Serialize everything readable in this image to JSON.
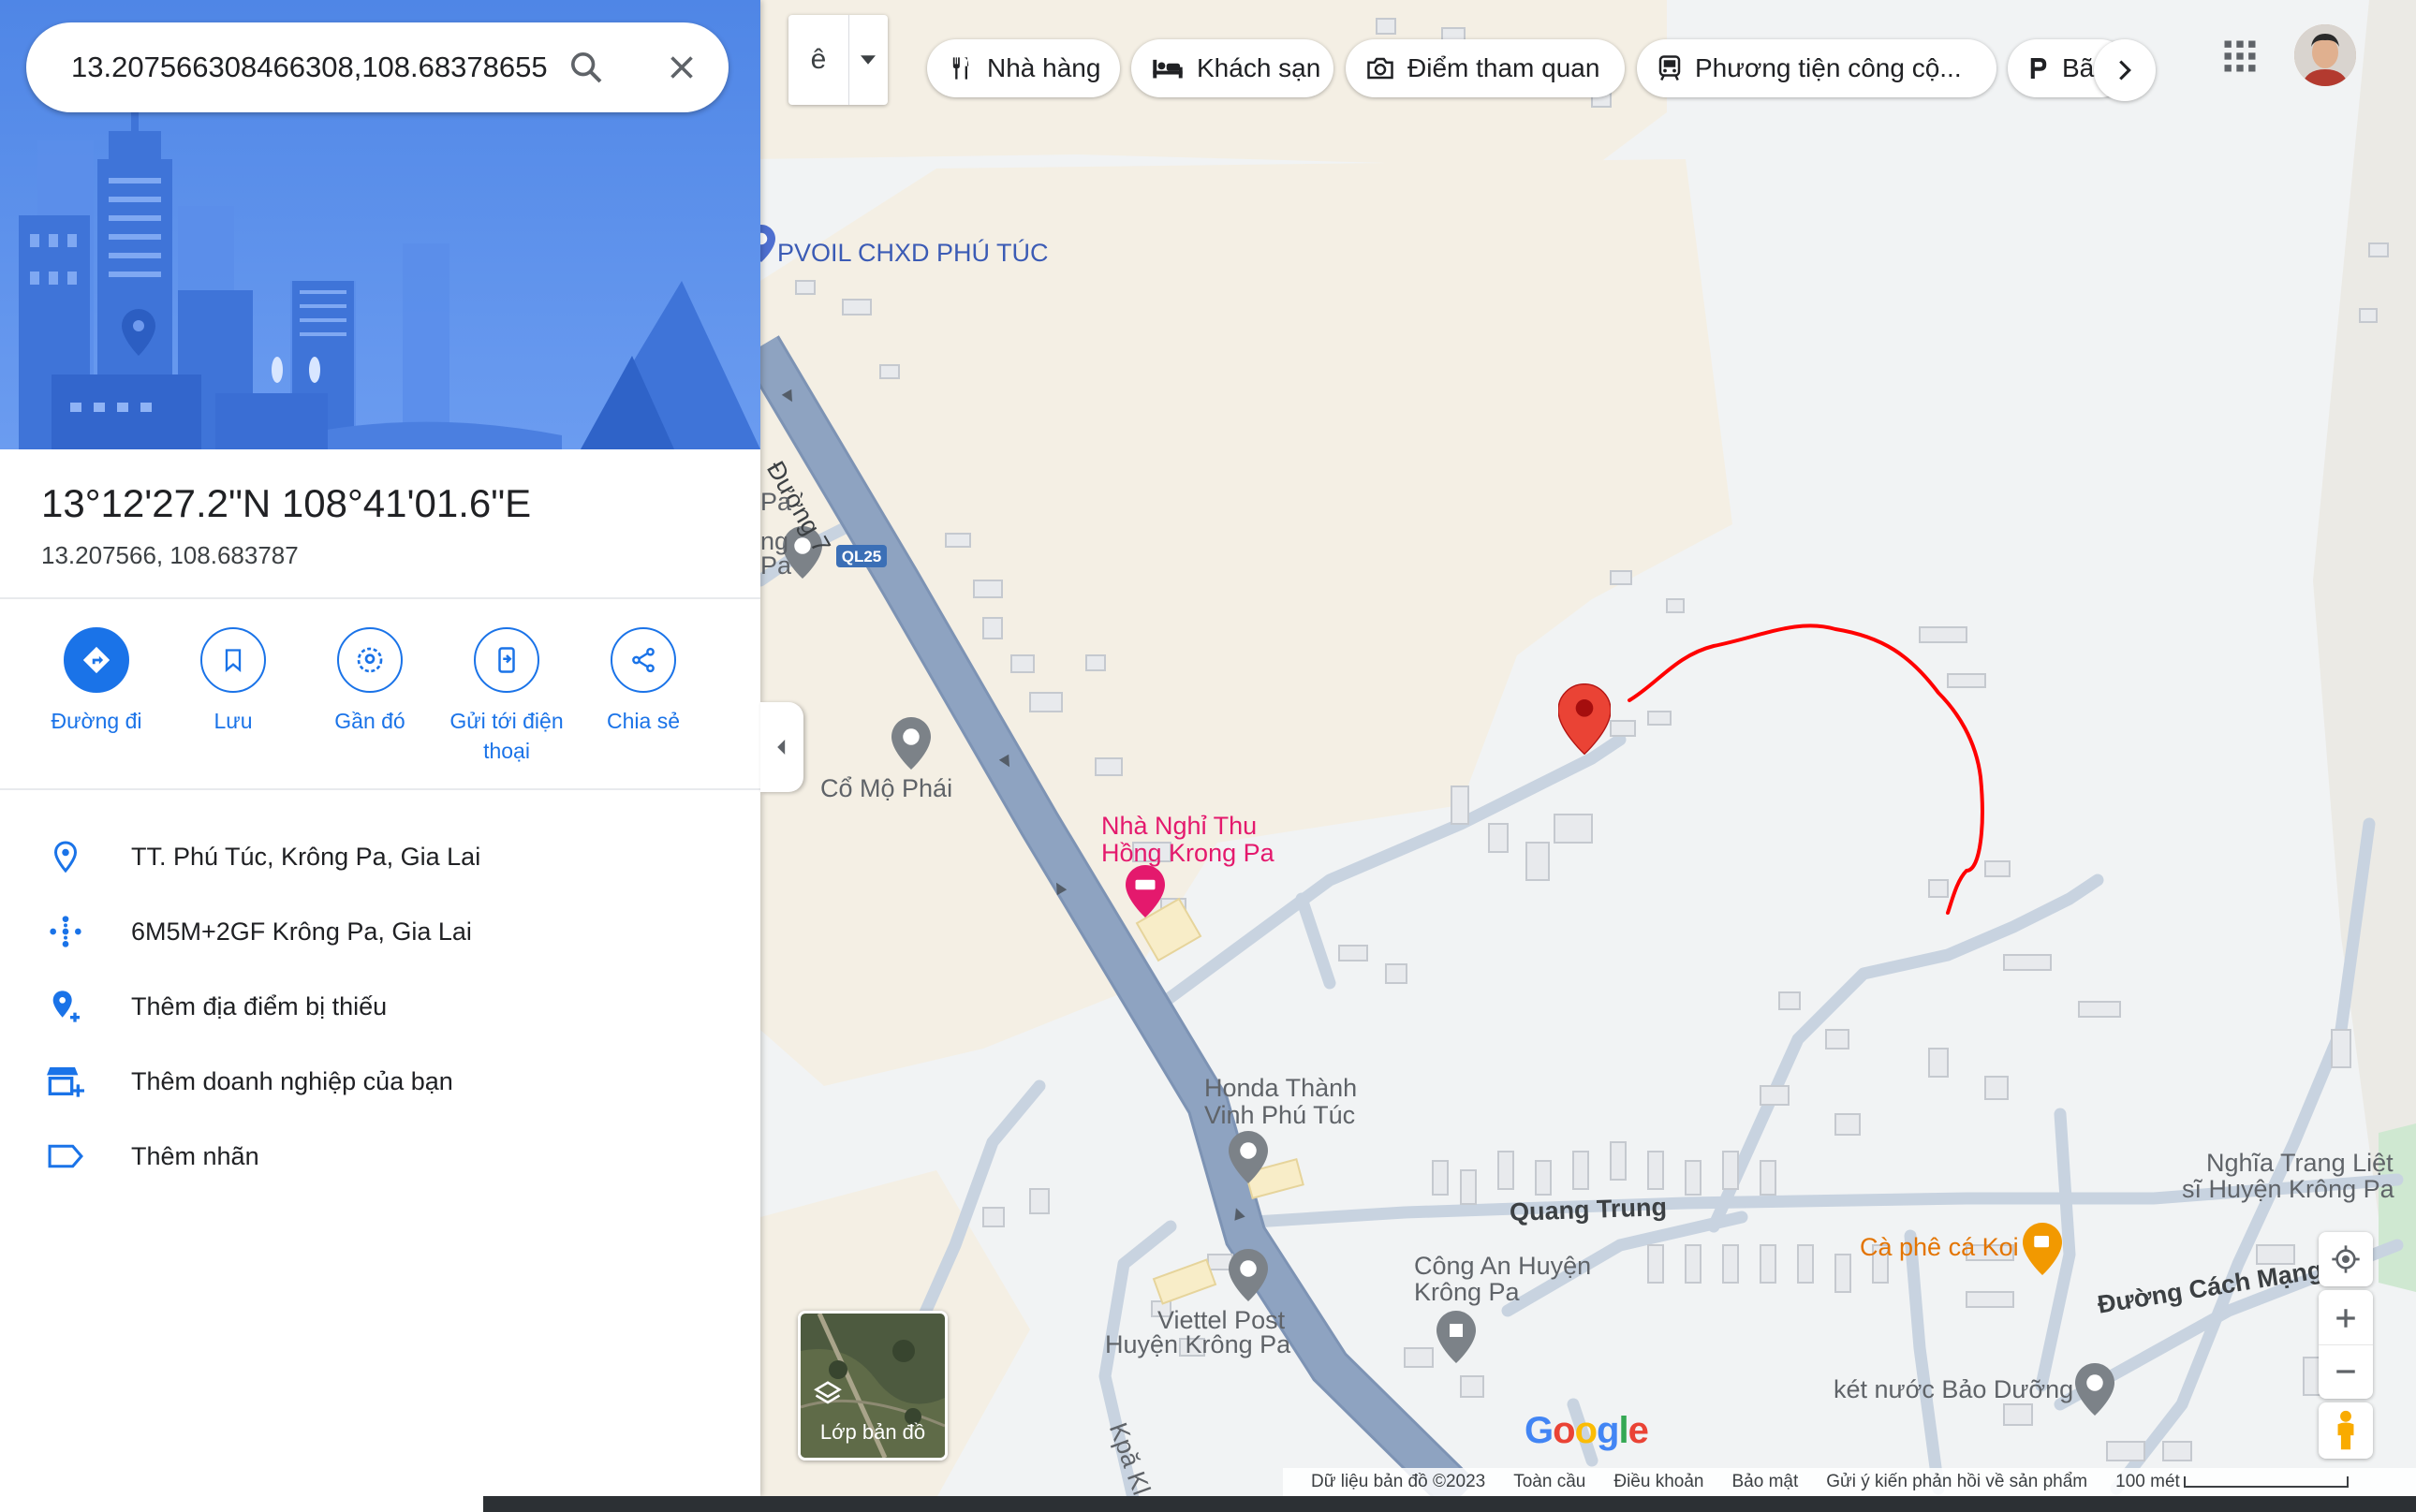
{
  "search": {
    "value": "13.207566308466308,108.68378655"
  },
  "place": {
    "dms": "13°12'27.2\"N 108°41'01.6\"E",
    "decimal": "13.207566, 108.683787"
  },
  "actions": [
    {
      "label": "Đường đi",
      "icon": "directions-icon"
    },
    {
      "label": "Lưu",
      "icon": "bookmark-icon"
    },
    {
      "label": "Gần đó",
      "icon": "nearby-icon"
    },
    {
      "label": "Gửi tới điện thoại",
      "icon": "send-to-phone-icon"
    },
    {
      "label": "Chia sẻ",
      "icon": "share-icon"
    }
  ],
  "info": [
    {
      "text": "TT. Phú Túc, Krông Pa, Gia Lai",
      "icon": "location-pin-icon"
    },
    {
      "text": "6M5M+2GF Krông Pa, Gia Lai",
      "icon": "plus-code-icon"
    },
    {
      "text": "Thêm địa điểm bị thiếu",
      "icon": "add-place-icon"
    },
    {
      "text": "Thêm doanh nghiệp của bạn",
      "icon": "add-business-icon"
    },
    {
      "text": "Thêm nhãn",
      "icon": "label-icon"
    }
  ],
  "mode_button": {
    "label": "ê"
  },
  "chips": [
    {
      "label": "Nhà hàng",
      "icon": "restaurant-icon"
    },
    {
      "label": "Khách sạn",
      "icon": "hotel-icon"
    },
    {
      "label": "Điểm tham quan",
      "icon": "camera-icon"
    },
    {
      "label": "Phương tiện công cộ...",
      "icon": "transit-icon"
    },
    {
      "label": "Bã",
      "icon": "parking-icon"
    }
  ],
  "map_labels": {
    "pvoil": "PVOIL CHXD PHÚ TÚC",
    "duong7": "Đường 7",
    "ql25": "QL25",
    "pa1": "Pa",
    "ng": "ng",
    "pa2": "Pa",
    "co_mo_phai": "Cổ Mộ Phái",
    "nha_nghi_1": "Nhà Nghỉ Thu",
    "nha_nghi_2": "Hồng Krong Pa",
    "honda_1": "Honda Thành",
    "honda_2": "Vinh Phú Túc",
    "quang_trung": "Quang Trung",
    "nghia_trang_1": "Nghĩa Trang Liệt",
    "nghia_trang_2": "sĩ Huyện Krông Pa",
    "ca_phe": "Cà phê cá Koi",
    "cong_an_1": "Công An Huyện",
    "cong_an_2": "Krông Pa",
    "viettel_1": "Viettel Post",
    "viettel_2": "Huyện Krông Pa",
    "duong_cach_mang": "Đường Cách Mạng",
    "ket_nuoc": "két nước Bảo Dưỡng",
    "kpa": "Kpă Kl"
  },
  "layers": {
    "label": "Lớp bản đồ"
  },
  "footer": {
    "data": "Dữ liệu bản đồ ©2023",
    "global": "Toàn cầu",
    "terms": "Điều khoản",
    "privacy": "Bảo mật",
    "feedback": "Gửi ý kiến phản hồi về sản phẩm",
    "scale": "100 mét"
  },
  "logo": {
    "text": "Google"
  },
  "colors": {
    "accent": "#1a73e8",
    "map_bg": "#f1f3f4",
    "terrain": "#f4efe4",
    "road_main": "#8da2c0",
    "road_local": "#c8d3e0",
    "pin": "#ea4335",
    "annotation_line": "#ff0000"
  }
}
